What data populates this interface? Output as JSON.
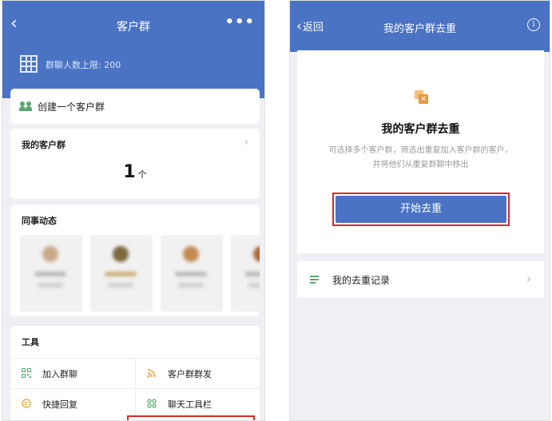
{
  "left_screen": {
    "nav": {
      "back_glyph": "‹",
      "title": "客户群",
      "more_glyph": "•••"
    },
    "limit": {
      "icon": "grid-icon",
      "text": "群聊人数上限: 200"
    },
    "create_group": {
      "icon": "people-icon",
      "label": "创建一个客户群"
    },
    "my_groups": {
      "title": "我的客户群",
      "count": "1",
      "unit": "个"
    },
    "colleague_activity": {
      "title": "同事动态"
    },
    "tools": {
      "title": "工具",
      "items": [
        {
          "label": "加入群聊",
          "icon": "qr-code-icon"
        },
        {
          "label": "客户群群发",
          "icon": "broadcast-icon"
        },
        {
          "label": "快捷回复",
          "icon": "quick-reply-icon"
        },
        {
          "label": "聊天工具栏",
          "icon": "toolbar-icon"
        }
      ]
    }
  },
  "right_screen": {
    "nav": {
      "back_label": "返回",
      "back_glyph": "‹",
      "title": "我的客户群去重",
      "info_glyph": "i"
    },
    "dedupe": {
      "title": "我的客户群去重",
      "description": "可选择多个客户群，筛选出重复加入客户群的客户，并将他们从重复群聊中移出",
      "start_button": "开始去重",
      "highlight_color": "#d62b2b"
    },
    "records": {
      "label": "我的去重记录"
    }
  },
  "colors": {
    "primary": "#4a73c4",
    "background": "#efeff4",
    "accent_green": "#58a86b",
    "accent_orange": "#e9973c"
  }
}
